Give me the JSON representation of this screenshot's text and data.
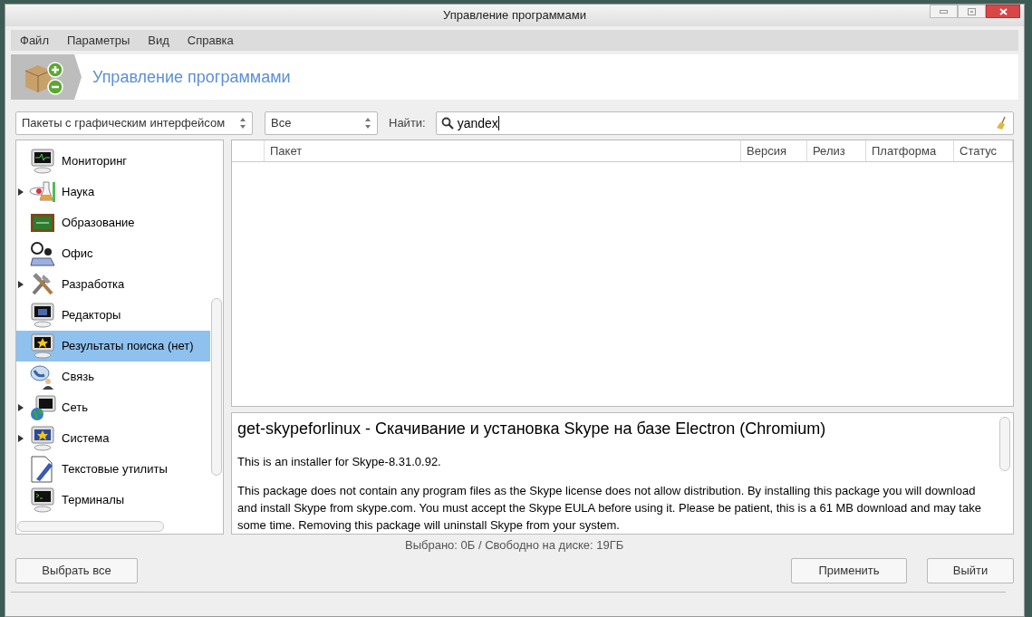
{
  "window": {
    "title": "Управление программами"
  },
  "menu": [
    "Файл",
    "Параметры",
    "Вид",
    "Справка"
  ],
  "header": {
    "title": "Управление программами"
  },
  "filters": {
    "type": "Пакеты с графическим интерфейсом",
    "state": "Все",
    "search_label": "Найти:",
    "search_value": "yandex"
  },
  "categories": [
    {
      "label": "Мониторинг",
      "has_children": false,
      "selected": false
    },
    {
      "label": "Наука",
      "has_children": true,
      "selected": false
    },
    {
      "label": "Образование",
      "has_children": false,
      "selected": false
    },
    {
      "label": "Офис",
      "has_children": false,
      "selected": false
    },
    {
      "label": "Разработка",
      "has_children": true,
      "selected": false
    },
    {
      "label": "Редакторы",
      "has_children": false,
      "selected": false
    },
    {
      "label": "Результаты поиска (нет)",
      "has_children": false,
      "selected": true
    },
    {
      "label": "Связь",
      "has_children": false,
      "selected": false
    },
    {
      "label": "Сеть",
      "has_children": true,
      "selected": false
    },
    {
      "label": "Система",
      "has_children": true,
      "selected": false
    },
    {
      "label": "Текстовые утилиты",
      "has_children": false,
      "selected": false
    },
    {
      "label": "Терминалы",
      "has_children": false,
      "selected": false
    }
  ],
  "table": {
    "columns": [
      "Пакет",
      "Версия",
      "Релиз",
      "Платформа",
      "Статус"
    ]
  },
  "description": {
    "title": "get-skypeforlinux - Скачивание и установка Skype на базе Electron (Chromium)",
    "paragraphs": [
      "This is an installer for Skype-8.31.0.92.",
      "This package does not contain any program files as the Skype license does not allow distribution. By installing this package you will download and install Skype from skype.com. You must accept the Skype EULA before using it. Please be patient, this is a 61 MB download and may take some time. Removing this package will uninstall Skype from your system."
    ]
  },
  "status_bar": "Выбрано: 0Б / Свободно на диске: 19ГБ",
  "buttons": {
    "select_all": "Выбрать все",
    "apply": "Применить",
    "quit": "Выйти"
  }
}
